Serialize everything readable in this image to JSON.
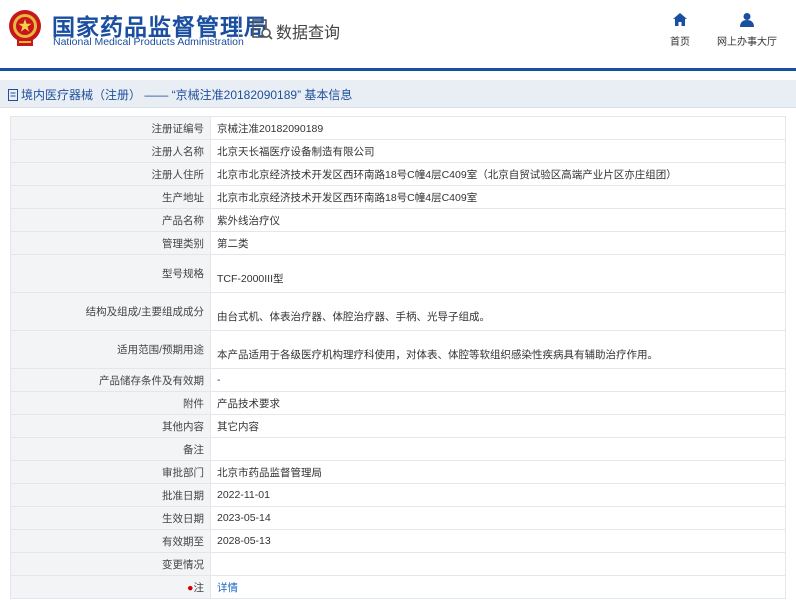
{
  "header": {
    "org_name_cn": "国家药品监督管理局",
    "org_name_en": "National Medical Products Administration",
    "query_title": "数据查询",
    "nav": [
      {
        "label": "首页",
        "icon": "home-icon"
      },
      {
        "label": "网上办事大厅",
        "icon": "user-icon"
      }
    ]
  },
  "breadcrumb": {
    "text": "境内医疗器械（注册） —— “京械注准20182090189” 基本信息"
  },
  "colors": {
    "brand": "#1a4ea0",
    "link": "#1a6ac0",
    "label_bg": "#f3f4f6",
    "crumb_bg": "#e9eef4"
  },
  "fields": [
    {
      "label": "注册证编号",
      "value": "京械注准20182090189"
    },
    {
      "label": "注册人名称",
      "value": "北京天长福医疗设备制造有限公司"
    },
    {
      "label": "注册人住所",
      "value": "北京市北京经济技术开发区西环南路18号C幢4层C409室（北京自贸试验区高端产业片区亦庄组团）"
    },
    {
      "label": "生产地址",
      "value": "北京市北京经济技术开发区西环南路18号C幢4层C409室"
    },
    {
      "label": "产品名称",
      "value": "紫外线治疗仪"
    },
    {
      "label": "管理类别",
      "value": "第二类"
    },
    {
      "label": "型号规格",
      "value": "TCF-2000III型"
    },
    {
      "label": "结构及组成/主要组成成分",
      "value": "由台式机、体表治疗器、体腔治疗器、手柄、光导子组成。"
    },
    {
      "label": "适用范围/预期用途",
      "value": "本产品适用于各级医疗机构理疗科使用，对体表、体腔等软组织感染性疾病具有辅助治疗作用。"
    },
    {
      "label": "产品储存条件及有效期",
      "value": "-"
    },
    {
      "label": "附件",
      "value": "产品技术要求"
    },
    {
      "label": "其他内容",
      "value": "其它内容"
    },
    {
      "label": "备注",
      "value": ""
    },
    {
      "label": "审批部门",
      "value": "北京市药品监督管理局"
    },
    {
      "label": "批准日期",
      "value": "2022-11-01"
    },
    {
      "label": "生效日期",
      "value": "2023-05-14"
    },
    {
      "label": "有效期至",
      "value": "2028-05-13"
    },
    {
      "label": "变更情况",
      "value": ""
    },
    {
      "label": "注",
      "value": "详情"
    }
  ]
}
